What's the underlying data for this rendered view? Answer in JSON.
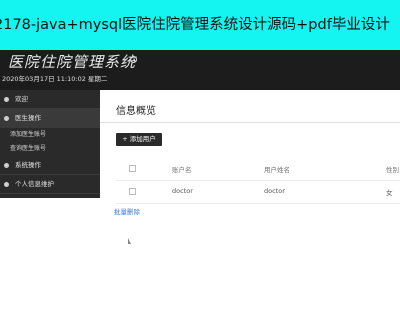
{
  "banner": {
    "text": "2178-java+mysql医院住院管理系统设计源码+pdf毕业设计"
  },
  "header": {
    "app_title": "医院住院管理系统",
    "datetime": "2020年03月17日 11:10:02 星期二"
  },
  "sidebar": {
    "items": [
      {
        "label": "欢迎",
        "icon": "home-icon"
      },
      {
        "label": "医生操作",
        "icon": "user-icon",
        "subitems": [
          "添加医生账号",
          "查询医生账号"
        ]
      },
      {
        "label": "系统操作",
        "icon": "gear-icon"
      },
      {
        "label": "个人信息维护",
        "icon": "info-icon"
      }
    ]
  },
  "content": {
    "title": "信息概览",
    "add_button": "+ 添加用户",
    "table": {
      "headers": [
        "账户名",
        "用户姓名",
        "性别"
      ],
      "rows": [
        [
          "doctor",
          "doctor",
          "女"
        ]
      ]
    },
    "delete_link": "批量删除"
  },
  "colors": {
    "banner": "#14f4f0",
    "header": "#1c1c1c",
    "sidebar": "#2a2a2a",
    "link": "#3a7bd5"
  }
}
